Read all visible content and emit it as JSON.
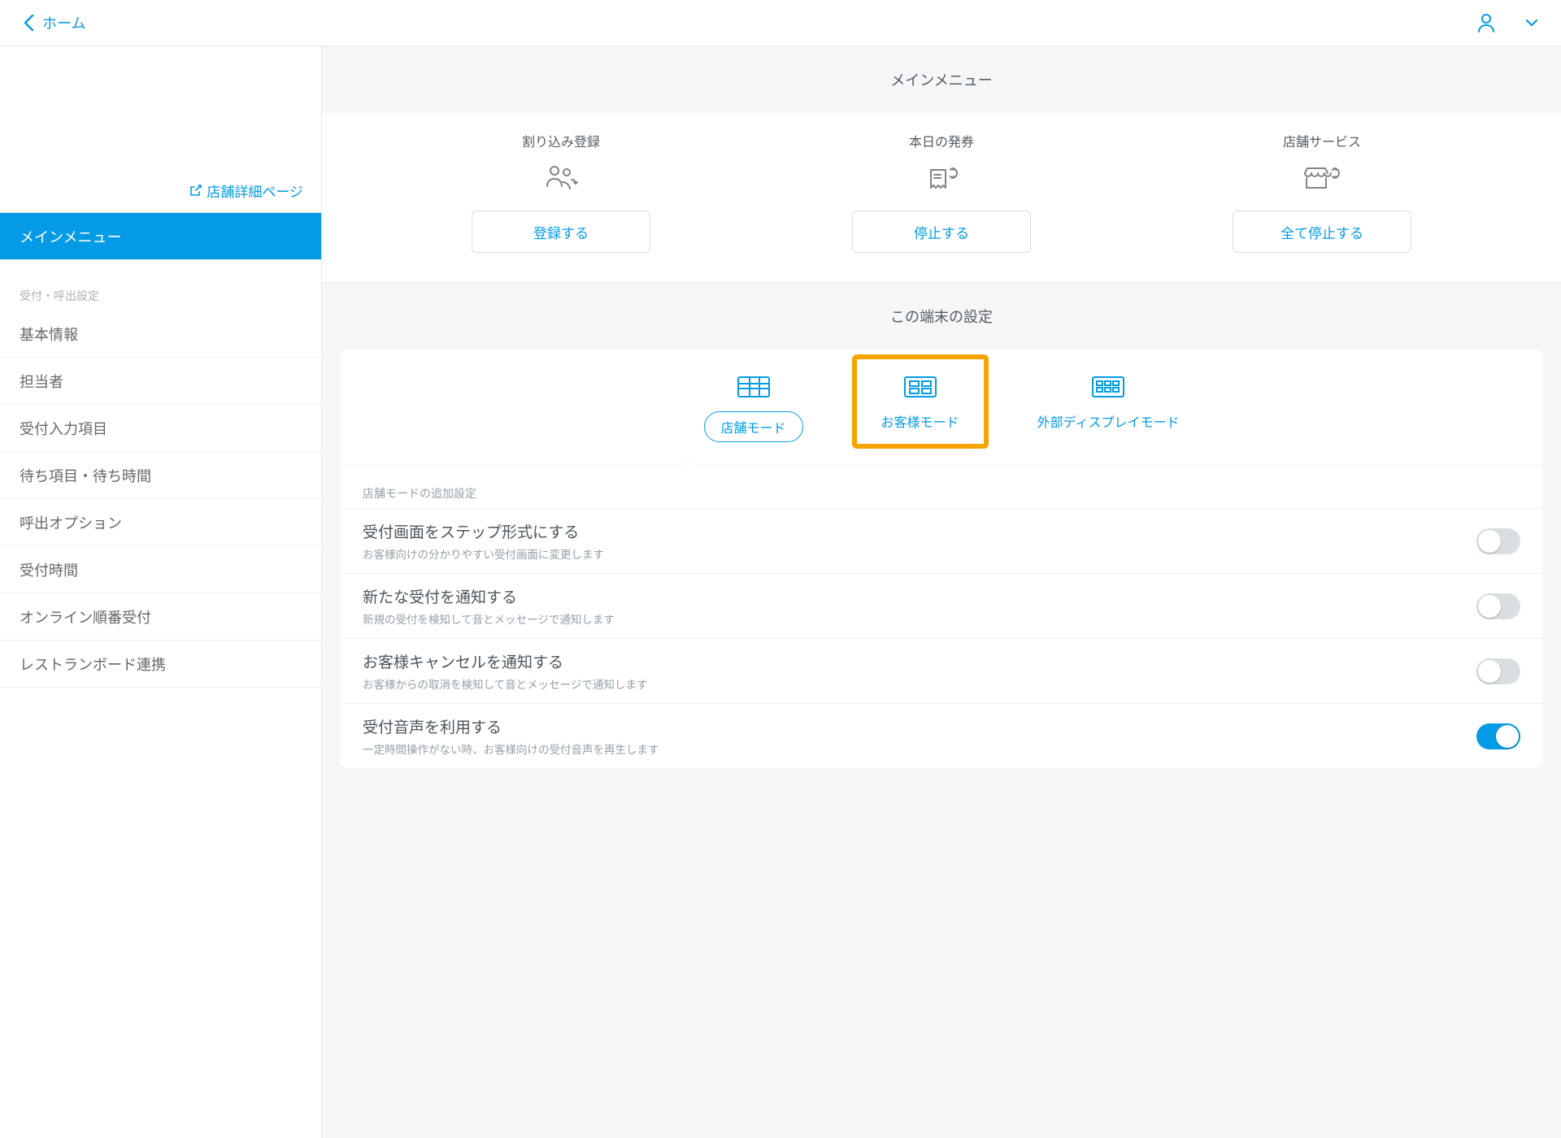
{
  "header": {
    "back_label": "ホーム"
  },
  "sidebar": {
    "store_detail": "店舗詳細ページ",
    "menu_active": "メインメニュー",
    "group_label": "受付・呼出設定",
    "items": [
      {
        "label": "基本情報"
      },
      {
        "label": "担当者"
      },
      {
        "label": "受付入力項目"
      },
      {
        "label": "待ち項目・待ち時間"
      },
      {
        "label": "呼出オプション"
      },
      {
        "label": "受付時間"
      },
      {
        "label": "オンライン順番受付"
      },
      {
        "label": "レストランボード連携"
      }
    ]
  },
  "content": {
    "main_title": "メインメニュー",
    "actions": [
      {
        "label": "割り込み登録",
        "button": "登録する"
      },
      {
        "label": "本日の発券",
        "button": "停止する"
      },
      {
        "label": "店舗サービス",
        "button": "全て停止する"
      }
    ],
    "device_title": "この端末の設定",
    "modes": [
      {
        "label": "店舗モード"
      },
      {
        "label": "お客様モード"
      },
      {
        "label": "外部ディスプレイモード"
      }
    ],
    "extra_caption": "店舗モードの追加設定",
    "settings": [
      {
        "title": "受付画面をステップ形式にする",
        "desc": "お客様向けの分かりやすい受付画面に変更します",
        "on": false
      },
      {
        "title": "新たな受付を通知する",
        "desc": "新規の受付を検知して音とメッセージで通知します",
        "on": false
      },
      {
        "title": "お客様キャンセルを通知する",
        "desc": "お客様からの取消を検知して音とメッセージで通知します",
        "on": false
      },
      {
        "title": "受付音声を利用する",
        "desc": "一定時間操作がない時、お客様向けの受付音声を再生します",
        "on": true
      }
    ]
  }
}
